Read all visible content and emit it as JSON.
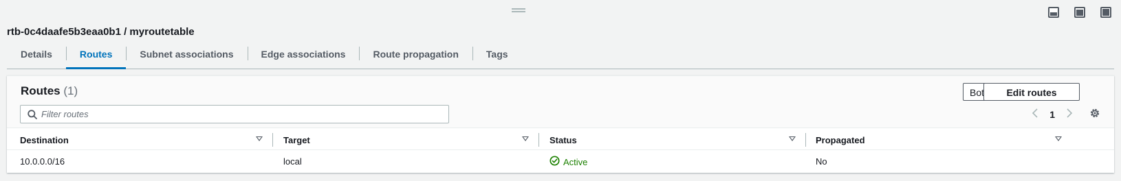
{
  "panel": {
    "title": "rtb-0c4daafe5b3eaa0b1 / myroutetable",
    "controls": [
      "panel-bottom-icon",
      "panel-side-icon",
      "panel-full-icon"
    ]
  },
  "tabs": [
    {
      "label": "Details",
      "active": false
    },
    {
      "label": "Routes",
      "active": true
    },
    {
      "label": "Subnet associations",
      "active": false
    },
    {
      "label": "Edge associations",
      "active": false
    },
    {
      "label": "Route propagation",
      "active": false
    },
    {
      "label": "Tags",
      "active": false
    }
  ],
  "routes": {
    "title": "Routes",
    "count": "(1)",
    "filter_select": "Both",
    "edit_label": "Edit routes",
    "search_placeholder": "Filter routes",
    "page": "1",
    "columns": [
      "Destination",
      "Target",
      "Status",
      "Propagated"
    ],
    "rows": [
      {
        "destination": "10.0.0.0/16",
        "target": "local",
        "status": "Active",
        "propagated": "No"
      }
    ]
  },
  "colors": {
    "accent": "#0073bb",
    "active_status": "#1d8102",
    "text": "#16191f",
    "muted": "#545b64"
  }
}
